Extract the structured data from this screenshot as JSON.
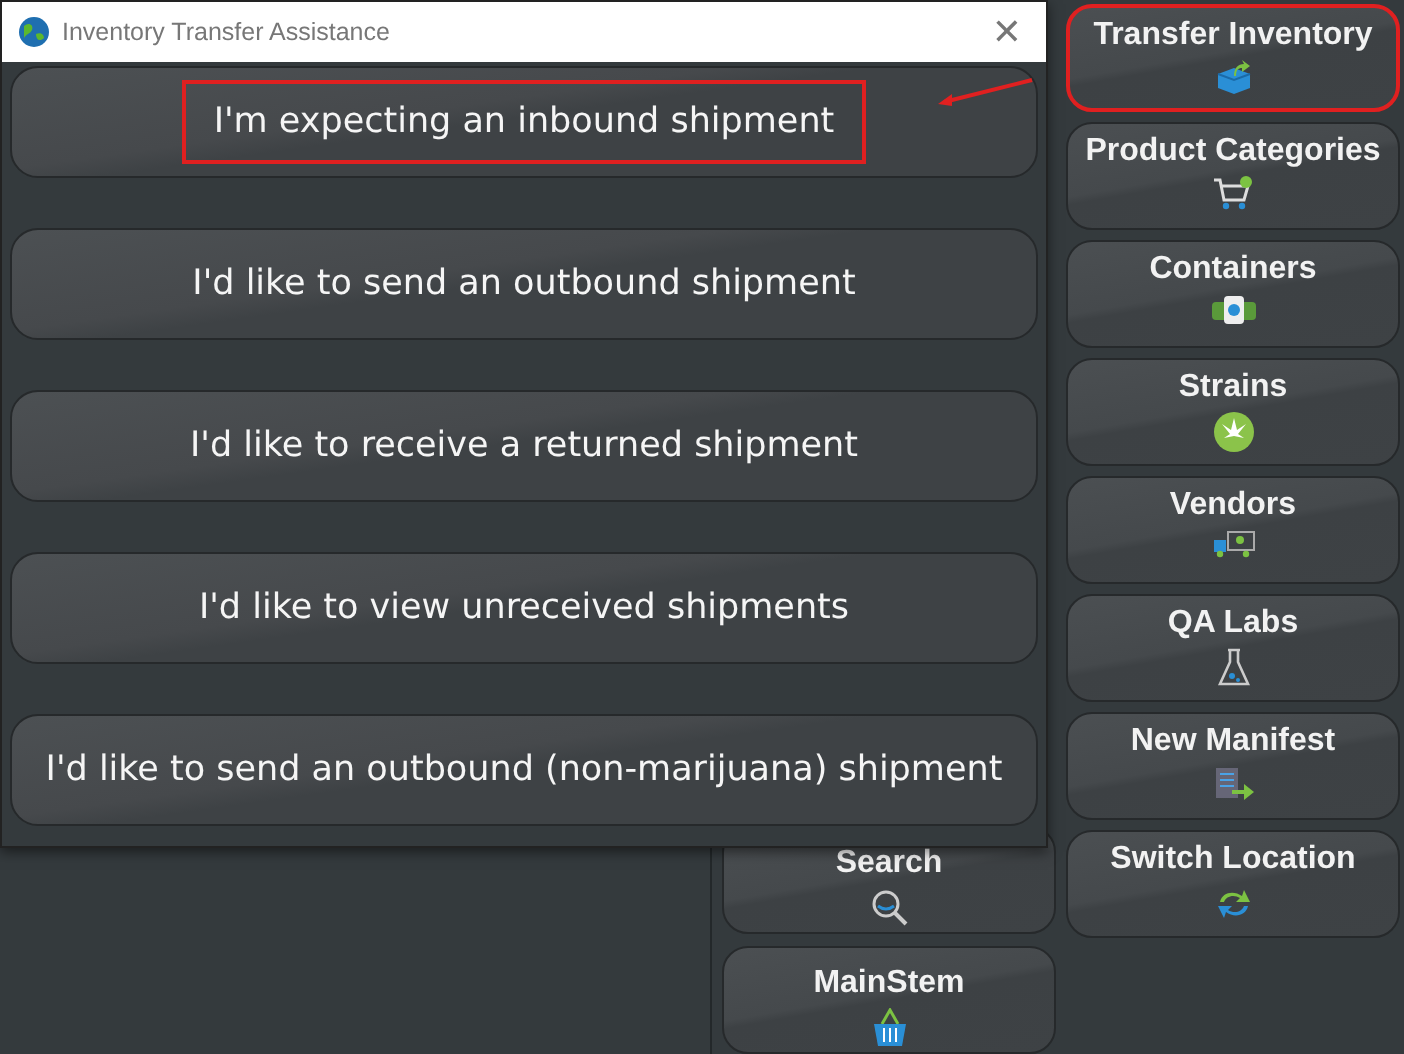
{
  "dialog": {
    "title": "Inventory Transfer Assistance",
    "close": "✕",
    "options": [
      {
        "label": "I'm expecting an inbound shipment",
        "highlighted": true
      },
      {
        "label": "I'd like to send an outbound shipment",
        "highlighted": false
      },
      {
        "label": "I'd like to receive a returned shipment",
        "highlighted": false
      },
      {
        "label": "I'd like to view unreceived shipments",
        "highlighted": false
      },
      {
        "label": "I'd like to send an outbound (non-marijuana) shipment",
        "highlighted": false
      }
    ]
  },
  "middle_column": [
    {
      "label": "Search"
    },
    {
      "label": "MainStem"
    }
  ],
  "sidebar": [
    {
      "label": "Transfer Inventory",
      "highlighted": true
    },
    {
      "label": "Product Categories",
      "highlighted": false
    },
    {
      "label": "Containers",
      "highlighted": false
    },
    {
      "label": "Strains",
      "highlighted": false
    },
    {
      "label": "Vendors",
      "highlighted": false
    },
    {
      "label": "QA Labs",
      "highlighted": false
    },
    {
      "label": "New Manifest",
      "highlighted": false
    },
    {
      "label": "Switch Location",
      "highlighted": false
    }
  ]
}
